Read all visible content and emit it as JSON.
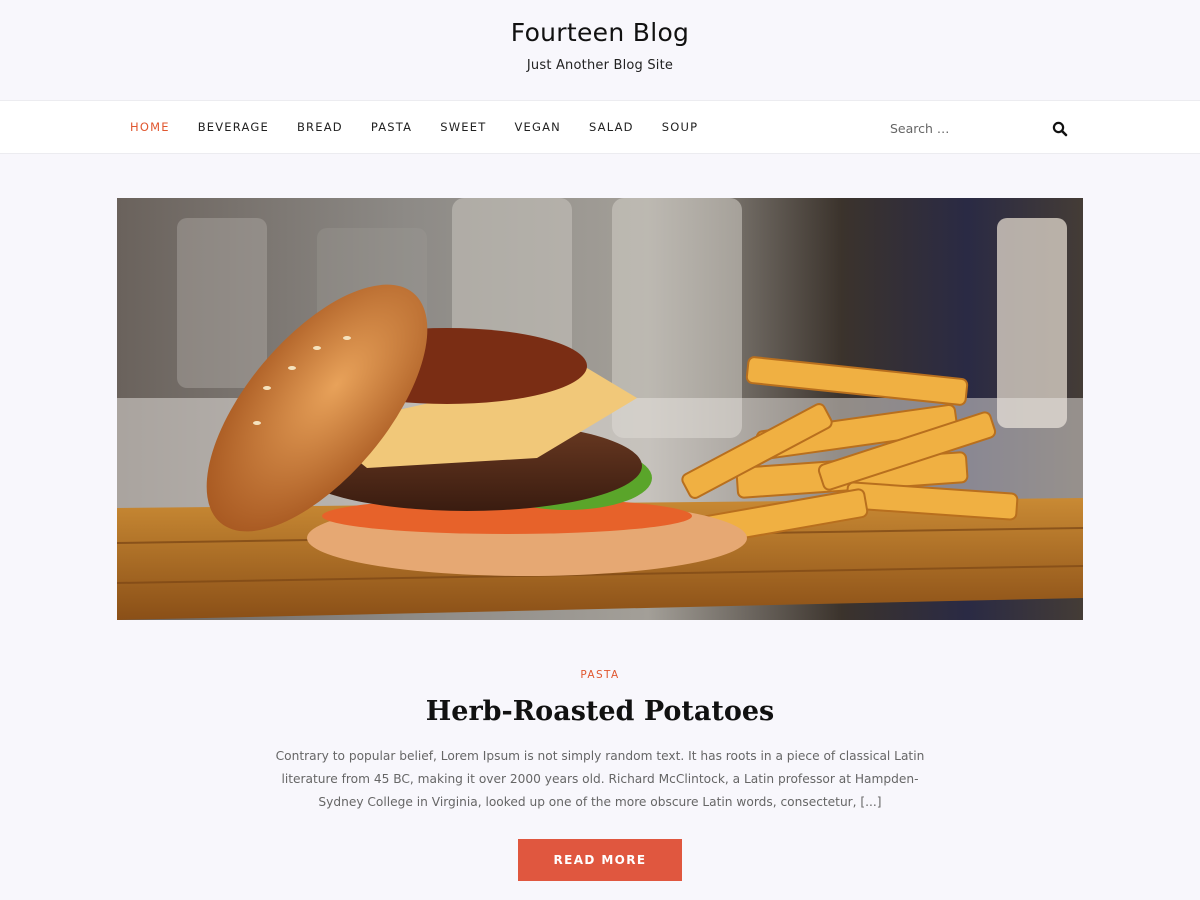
{
  "site": {
    "title": "Fourteen Blog",
    "tagline": "Just Another Blog Site"
  },
  "nav": {
    "items": [
      {
        "label": "HOME",
        "active": true
      },
      {
        "label": "BEVERAGE"
      },
      {
        "label": "BREAD"
      },
      {
        "label": "PASTA"
      },
      {
        "label": "SWEET"
      },
      {
        "label": "VEGAN"
      },
      {
        "label": "SALAD"
      },
      {
        "label": "SOUP"
      }
    ],
    "search": {
      "placeholder": "Search …",
      "icon": "search-icon"
    }
  },
  "post": {
    "image": "burger-and-fries-photo",
    "category": "PASTA",
    "title": "Herb-Roasted Potatoes",
    "excerpt": "Contrary to popular belief, Lorem Ipsum is not simply random text. It has roots in a piece of classical Latin literature from 45 BC, making it over 2000 years old. Richard McClintock, a Latin professor at Hampden-Sydney College in Virginia, looked up one of the more obscure Latin words, consectetur, [...]",
    "read_more_label": "READ MORE"
  },
  "colors": {
    "accent": "#e0572f",
    "button": "#e0573f",
    "background": "#f8f7fc"
  }
}
